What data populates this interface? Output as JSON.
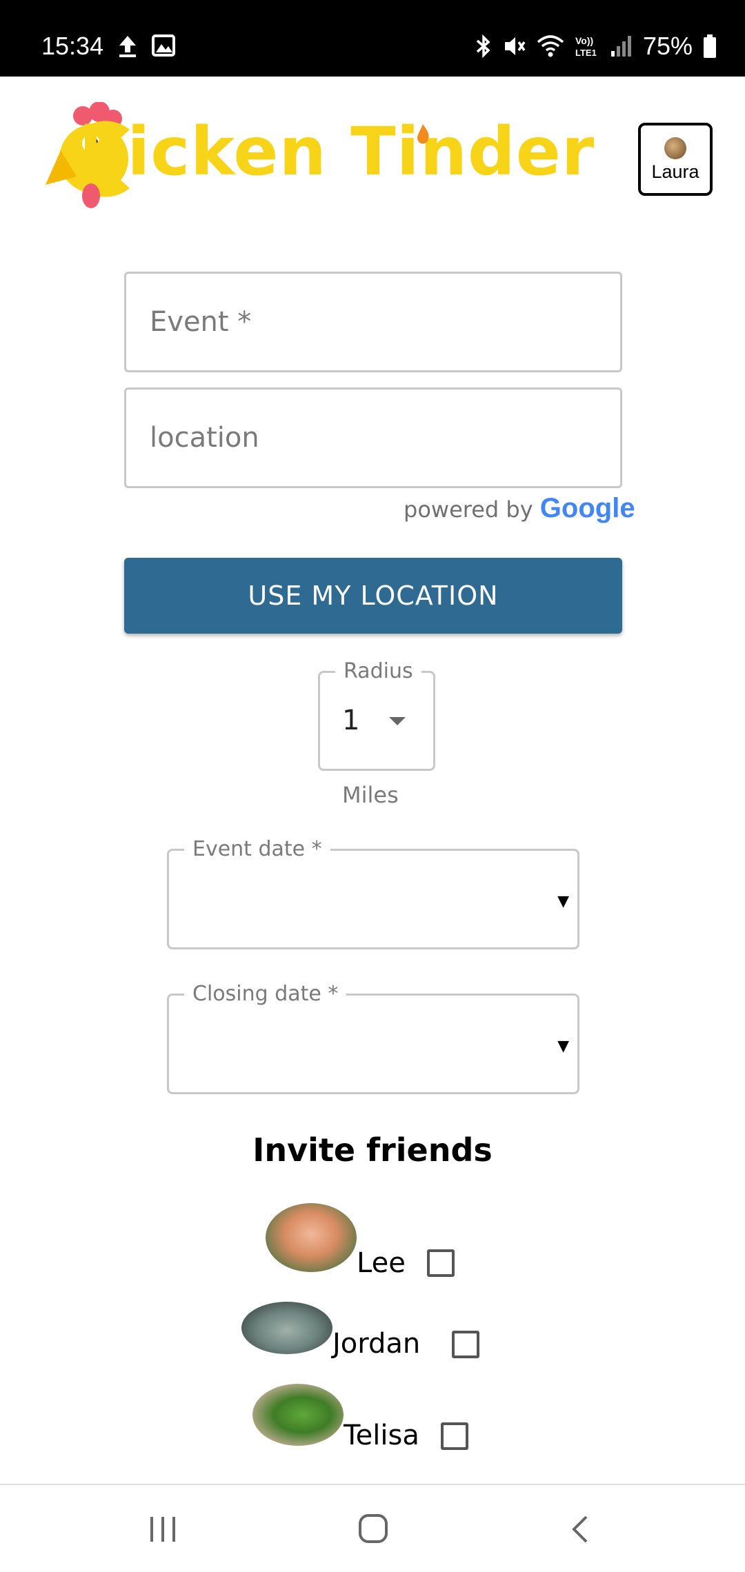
{
  "status_bar": {
    "time": "15:34",
    "battery": "75%",
    "icons": [
      "upload-icon",
      "image-icon",
      "bluetooth-icon",
      "mute-icon",
      "wifi-icon",
      "volte-icon",
      "signal-icon",
      "battery-icon"
    ]
  },
  "header": {
    "logo_text": "hicken Tinder",
    "profile_name": "Laura"
  },
  "form": {
    "event_placeholder": "Event *",
    "location_placeholder": "location",
    "powered_by": "powered by",
    "powered_by_brand": "Google",
    "use_location_label": "USE MY LOCATION",
    "radius_label": "Radius",
    "radius_value": "1",
    "radius_unit": "Miles",
    "event_date_label": "Event date *",
    "closing_date_label": "Closing date *"
  },
  "invite": {
    "title": "Invite friends",
    "friends": [
      {
        "name": "Lee",
        "checked": false
      },
      {
        "name": "Jordan",
        "checked": false
      },
      {
        "name": "Telisa",
        "checked": false
      }
    ]
  },
  "colors": {
    "brand_yellow": "#F7D417",
    "button_blue": "#2E6A91",
    "border_gray": "#C8C8C8"
  }
}
